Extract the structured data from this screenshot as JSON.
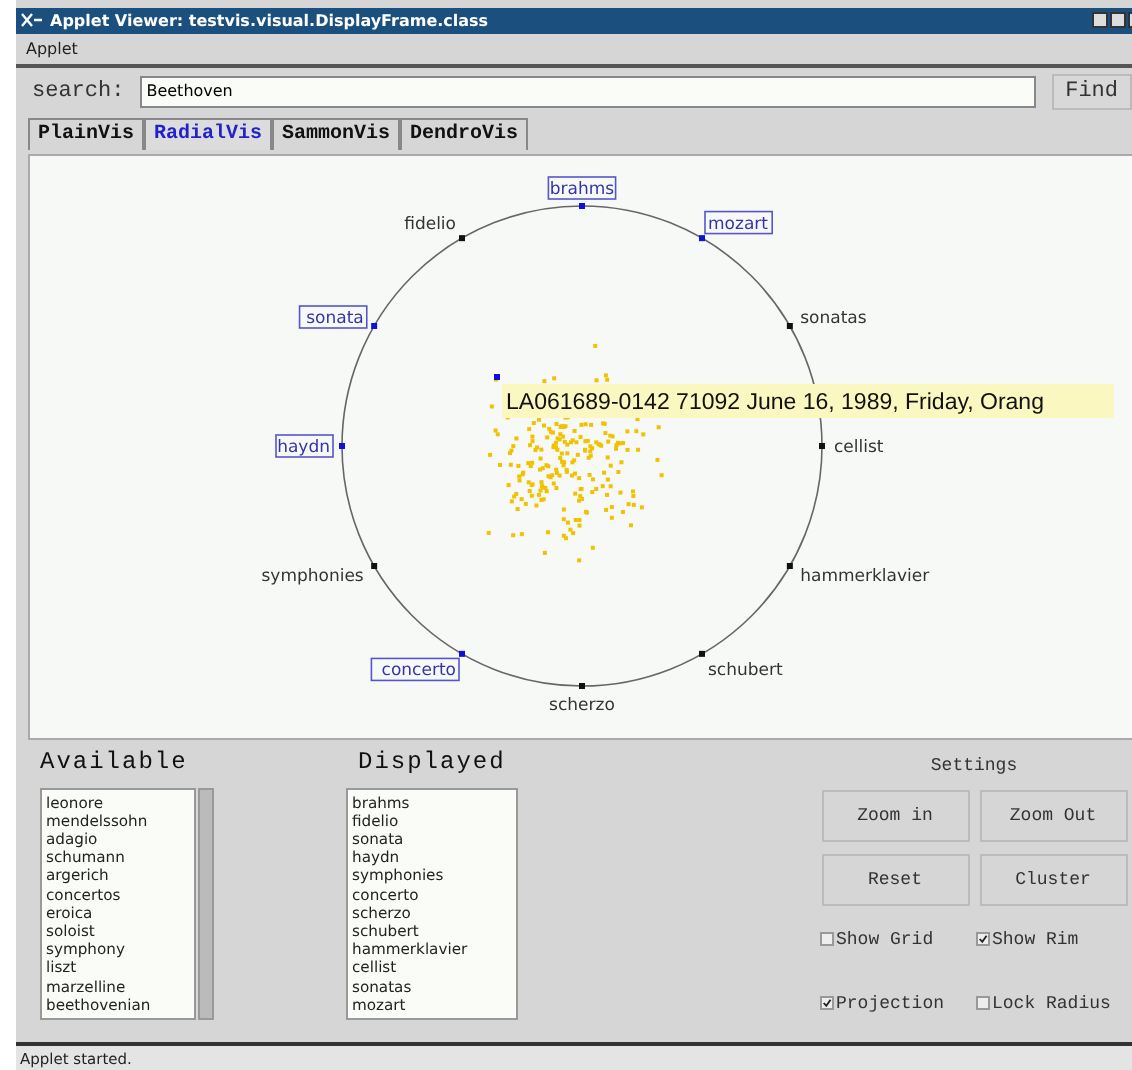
{
  "window": {
    "title": "Applet Viewer: testvis.visual.DisplayFrame.class"
  },
  "menu": [
    "Applet"
  ],
  "search": {
    "label": "search:",
    "value": "Beethoven",
    "button": "Find"
  },
  "tabs": [
    {
      "label": "PlainVis",
      "selected": false
    },
    {
      "label": "RadialVis",
      "selected": true
    },
    {
      "label": "SammonVis",
      "selected": false
    },
    {
      "label": "DendroVis",
      "selected": false
    }
  ],
  "radial": {
    "right_arc": [
      {
        "label": "brahms",
        "highlighted": true
      },
      {
        "label": "mozart",
        "highlighted": true
      },
      {
        "label": "sonatas",
        "highlighted": false
      },
      {
        "label": "cellist",
        "highlighted": false
      },
      {
        "label": "hammerklavier",
        "highlighted": false
      },
      {
        "label": "schubert",
        "highlighted": false
      },
      {
        "label": "scherzo",
        "highlighted": false
      }
    ],
    "left_arc": [
      {
        "label": "fidelio",
        "highlighted": false
      },
      {
        "label": "sonata",
        "highlighted": true
      },
      {
        "label": "haydn",
        "highlighted": true
      },
      {
        "label": "symphonies",
        "highlighted": false
      },
      {
        "label": "concerto",
        "highlighted": true
      }
    ],
    "tooltip": "LA061689-0142 71092 June 16, 1989, Friday, Orang"
  },
  "available": {
    "title": "Available",
    "items": [
      "leonore",
      "mendelssohn",
      "adagio",
      "schumann",
      "argerich",
      "concertos",
      "eroica",
      "soloist",
      "symphony",
      "liszt",
      "marzelline",
      "beethovenian"
    ]
  },
  "displayed": {
    "title": "Displayed",
    "items": [
      "brahms",
      "fidelio",
      "sonata",
      "haydn",
      "symphonies",
      "concerto",
      "scherzo",
      "schubert",
      "hammerklavier",
      "cellist",
      "sonatas",
      "mozart"
    ]
  },
  "settings": {
    "title": "Settings",
    "buttons": [
      "Zoom in",
      "Zoom Out",
      "Reset",
      "Cluster"
    ],
    "options": [
      {
        "label": "Show Grid",
        "checked": false
      },
      {
        "label": "Show Rim",
        "checked": true
      },
      {
        "label": "Projection",
        "checked": true
      },
      {
        "label": "Lock Radius",
        "checked": false
      }
    ]
  },
  "status_bar": "Applet started."
}
